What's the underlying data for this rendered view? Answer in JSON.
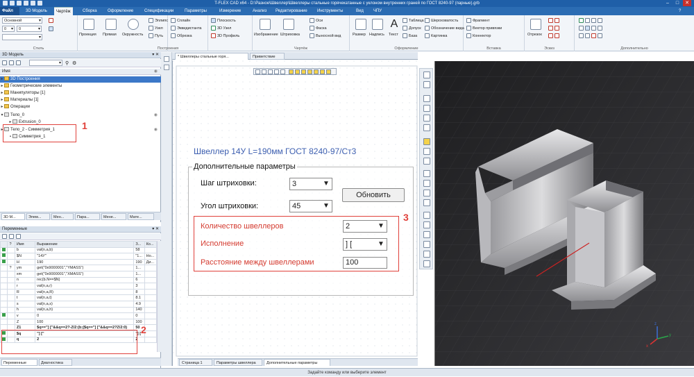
{
  "window": {
    "title": "T-FLEX CAD x64 - D:\\Разное\\Швеллер\\Швеллеры стальные горячекатанные с уклоном внутренних граней по ГОСТ 8240-97 (парные).grb"
  },
  "ribbon_tabs": {
    "file": "Файл",
    "model3d": "3D Модель",
    "drawing": "Чертёж",
    "assembly": "Сборка",
    "layout": "Оформление",
    "specs": "Спецификации",
    "params": "Параметры",
    "measure": "Измерение",
    "analysis": "Анализ",
    "edit": "Редактирование",
    "tools": "Инструменты",
    "view": "Вид",
    "chpu": "ЧПУ"
  },
  "ribbon": {
    "style_combo": "Основной",
    "layer_num": "0",
    "style_num": "0",
    "style_group": "Стиль",
    "projection": "Проекция",
    "line": "Прямая",
    "circle": "Окружность",
    "ellipse": "Эллипс",
    "node": "Узел",
    "path": "Путь",
    "spline": "Сплайн",
    "equidistant": "Эквидистанта",
    "trim": "Обрезка",
    "build_group": "Построения",
    "plane": "Плоскость",
    "node3d": "3D Узел",
    "profile3d": "3D Профиль",
    "image": "Изображение",
    "hatch": "Штриховка",
    "axis": "Оси",
    "chamfer": "Фаска",
    "leader_view": "Выносной вид",
    "drawing_group": "Чертёж",
    "size": "Размер",
    "note": "Надпись",
    "text": "Текст",
    "table": "Таблица",
    "tolerance": "Допуск",
    "base": "База",
    "roughness": "Шероховатость",
    "view_mark": "Обозначение вида",
    "picture": "Картинка",
    "layout_group": "Оформление",
    "fragment": "Фрагмент",
    "snap_vector": "Вектор привязки",
    "connector": "Коннектор",
    "insert_group": "Вставка",
    "segment": "Отрезок",
    "sketch_group": "Эскиз",
    "extra_group": "Дополнительно"
  },
  "panel3d": {
    "title": "3D Модель",
    "col_name": "Имя",
    "items": [
      {
        "label": "3D Построения",
        "selected": true
      },
      {
        "label": "Геометрические элементы"
      },
      {
        "label": "Манипуляторы [1]"
      },
      {
        "label": "Материалы [1]"
      },
      {
        "label": "Операции"
      },
      {
        "label": "Тело_0"
      },
      {
        "label": "Extrusion_0"
      },
      {
        "label": "Тело_2 - Симметрия_1"
      },
      {
        "label": "Симметрия_1"
      }
    ],
    "callout": "1",
    "tabs": [
      "3D М...",
      "Элем...",
      "Мен...",
      "Пара...",
      "Мене...",
      "Мате..."
    ]
  },
  "panelvars": {
    "title": "Переменные",
    "headers": [
      "?",
      "Имя",
      "Выражение",
      "З...",
      "Ко..."
    ],
    "rows": [
      [
        "",
        "b",
        "val(n,a,b)",
        "58",
        ""
      ],
      [
        "",
        "$N",
        "\"14У\"",
        "\"1...",
        "Но..."
      ],
      [
        "",
        "H",
        "190",
        "190",
        "Ди..."
      ],
      [
        "?",
        "ym",
        "get(\"0x9000001\",\"YMASS\")",
        "1...",
        ""
      ],
      [
        "",
        "xm",
        "get(\"0x9000001\",\"XMASS\")",
        "1...",
        ""
      ],
      [
        "",
        "n",
        "rec(b.N==$N)",
        "6",
        ""
      ],
      [
        "",
        "r",
        "val(n,a,r)",
        "3",
        ""
      ],
      [
        "",
        "R",
        "val(n,a,R)",
        "8",
        ""
      ],
      [
        "",
        "t",
        "val(n,a,t)",
        "8.1",
        ""
      ],
      [
        "",
        "s",
        "val(n,a,s)",
        "4.9",
        ""
      ],
      [
        "",
        "h",
        "val(n,a,h)",
        "140",
        ""
      ],
      [
        "",
        "v",
        "0",
        "0",
        ""
      ],
      [
        "",
        "Z",
        "100",
        "100",
        ""
      ],
      [
        "",
        "Z1",
        "$q==\"] [\"&&q==2?-Z/2:(b;($q==\"] [\"&&q==2?Z/2:0)",
        "50",
        ""
      ],
      [
        "",
        "$q",
        "\"] [\"",
        "\"] [",
        ""
      ],
      [
        "",
        "q",
        "2",
        "2",
        ""
      ]
    ],
    "callout": "2",
    "tabs": [
      "Переменные",
      "Диагностика"
    ]
  },
  "doc_tabs": [
    "* Швеллеры стальные горя...",
    "Приветствие"
  ],
  "page_tabs": [
    "Страница 1",
    "Параметры швеллера",
    "Дополнительные параметры"
  ],
  "dialog": {
    "title": "Швеллер 14У L=190мм ГОСТ 8240-97/Ст3",
    "group_title": "Дополнительные параметры",
    "hatch_step_label": "Шаг штриховки:",
    "hatch_step_value": "3",
    "hatch_angle_label": "Угол штриховки:",
    "hatch_angle_value": "45",
    "update_button": "Обновить",
    "count_label": "Количество швеллеров",
    "count_value": "2",
    "variant_label": "Исполнение",
    "variant_value": "] [",
    "distance_label": "Расстояние между швеллерами",
    "distance_value": "100",
    "callout": "3"
  },
  "status": "Задайте команду или выберите элемент",
  "colors": {
    "accent": "#2b6cb3",
    "callout": "#e0403a",
    "dialog_title": "#3d5fb0"
  }
}
